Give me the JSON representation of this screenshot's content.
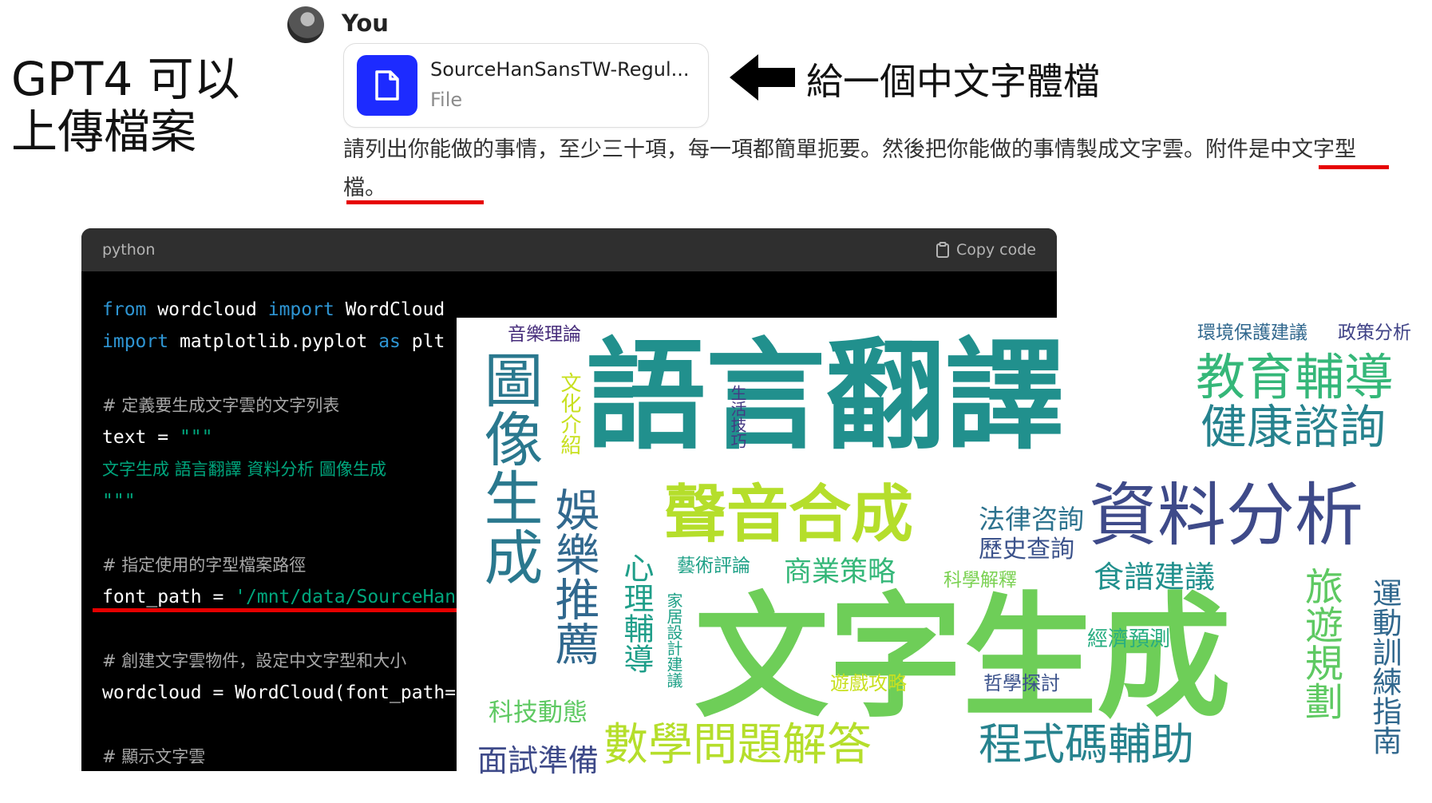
{
  "slide": {
    "title_line1": "GPT4 可以",
    "title_line2": "上傳檔案",
    "annotation": "給一個中文字體檔"
  },
  "chat": {
    "user_name": "You",
    "attachment": {
      "file_name": "SourceHanSansTW-Regul...",
      "file_type": "File"
    },
    "message_text": "請列出你能做的事情，至少三十項，每一項都簡單扼要。然後把你能做的事情製成文字雲。附件是中文字型檔。"
  },
  "code": {
    "language": "python",
    "copy_label": "Copy code",
    "lines": {
      "l1": {
        "a": "from",
        "b": " wordcloud ",
        "c": "import",
        "d": " WordCloud"
      },
      "l2": {
        "a": "import",
        "b": " matplotlib.pyplot ",
        "c": "as",
        "d": " plt"
      },
      "l4": "# 定義要生成文字雲的文字列表",
      "l5": {
        "a": "text = ",
        "b": "\"\"\""
      },
      "l6": "文字生成 語言翻譯 資料分析 圖像生成 ",
      "l7": "\"\"\"",
      "l9": "# 指定使用的字型檔案路徑",
      "l10": {
        "a": "font_path = ",
        "b": "'/mnt/data/SourceHan"
      },
      "l12": "# 創建文字雲物件，設定中文字型和大小",
      "l13": "wordcloud = WordCloud(font_path=",
      "l15": "# 顯示文字雲"
    }
  },
  "wordcloud": {
    "words": [
      {
        "text": "語言翻譯",
        "color": "#21908d"
      },
      {
        "text": "文字生成",
        "color": "#6ece58"
      },
      {
        "text": "圖像生成",
        "color": "#2a788e"
      },
      {
        "text": "資料分析",
        "color": "#3e4a89"
      },
      {
        "text": "聲音合成",
        "color": "#b5de2b"
      },
      {
        "text": "教育輔導",
        "color": "#35b779"
      },
      {
        "text": "健康諮詢",
        "color": "#26828e"
      },
      {
        "text": "娛樂推薦",
        "color": "#31688e"
      },
      {
        "text": "數學問題解答",
        "color": "#b5de2b"
      },
      {
        "text": "程式碼輔助",
        "color": "#26828e"
      },
      {
        "text": "面試準備",
        "color": "#3e4a89"
      },
      {
        "text": "旅遊規劃",
        "color": "#5ec962"
      },
      {
        "text": "運動訓練指南",
        "color": "#31688e"
      },
      {
        "text": "心理輔導",
        "color": "#1f9e89"
      },
      {
        "text": "商業策略",
        "color": "#35b779"
      },
      {
        "text": "食譜建議",
        "color": "#21908d"
      },
      {
        "text": "法律咨詢",
        "color": "#2c728e"
      },
      {
        "text": "歷史查詢",
        "color": "#3b528b"
      },
      {
        "text": "科技動態",
        "color": "#5ec962"
      },
      {
        "text": "音樂理論",
        "color": "#472d7b"
      },
      {
        "text": "文化介紹",
        "color": "#c8e020"
      },
      {
        "text": "生活技巧",
        "color": "#443983"
      },
      {
        "text": "藝術評論",
        "color": "#1fa187"
      },
      {
        "text": "科學解釋",
        "color": "#7ad151"
      },
      {
        "text": "經濟預測",
        "color": "#27ad81"
      },
      {
        "text": "遊戲攻略",
        "color": "#c8e020"
      },
      {
        "text": "哲學探討",
        "color": "#3b528b"
      },
      {
        "text": "家居設計建議",
        "color": "#1fa187"
      },
      {
        "text": "環境保護建議",
        "color": "#31688e"
      },
      {
        "text": "政策分析",
        "color": "#404387"
      }
    ]
  },
  "colors": {
    "file_icon_bg": "#1d2bff",
    "code_header_bg": "#2f2f2f",
    "code_bg": "#000000",
    "keyword": "#2e95d3",
    "string": "#00a67d",
    "comment": "#a8a8a8",
    "annotation_underline": "#e60000"
  },
  "icons": {
    "avatar": "user-avatar-photo",
    "file": "document-icon",
    "copy": "clipboard-icon",
    "arrow": "left-arrow-icon"
  }
}
